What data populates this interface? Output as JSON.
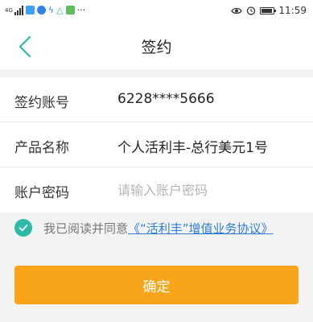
{
  "status_bar": {
    "network": "4G",
    "overflow": "···",
    "time": "11:59",
    "icons": [
      "signal-icon",
      "chat-app-icon",
      "browser-app-icon",
      "flash-icon",
      "triangle-app-icon",
      "notepad-app-icon",
      "eye-icon",
      "alarm-icon",
      "battery-icon"
    ]
  },
  "navbar": {
    "title": "签约",
    "back_icon": "chevron-left-icon"
  },
  "form": {
    "account": {
      "label": "签约账号",
      "value": "6228****5666"
    },
    "product": {
      "label": "产品名称",
      "value": "个人活利丰-总行美元1号"
    },
    "password": {
      "label": "账户密码",
      "placeholder": "请输入账户密码"
    }
  },
  "agreement": {
    "checked": true,
    "prefix": "我已阅读并同意",
    "link": "《“活利丰”增值业务协议》"
  },
  "confirm_label": "确定",
  "colors": {
    "accent": "#f9a51a",
    "teal": "#2dbaa7",
    "link": "#2f7fd8"
  }
}
